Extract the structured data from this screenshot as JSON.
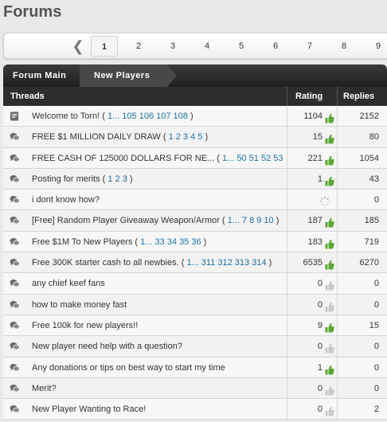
{
  "page_title": "Forums",
  "pagination": {
    "prev_icon": "chevron-left-icon",
    "pages": [
      "1",
      "2",
      "3",
      "4",
      "5",
      "6",
      "7",
      "8",
      "9"
    ],
    "current": "1"
  },
  "breadcrumb": {
    "items": [
      "Forum Main",
      "New Players"
    ]
  },
  "table": {
    "headers": {
      "threads": "Threads",
      "rating": "Rating",
      "replies": "Replies"
    },
    "rows": [
      {
        "icon": "sticky-note-icon",
        "title": "Welcome to Torn!",
        "pages": "1... 105 106 107 108",
        "rating": "1104",
        "thumb": "green",
        "replies": "2152"
      },
      {
        "icon": "chat-bubbles-icon",
        "title": "FREE $1 MILLION DAILY DRAW",
        "pages": "1 2 3 4 5",
        "rating": "15",
        "thumb": "green",
        "replies": "80"
      },
      {
        "icon": "chat-bubbles-icon",
        "title": "FREE CASH OF 125000 DOLLARS FOR NE...",
        "pages": "1... 50 51 52 53",
        "rating": "221",
        "thumb": "green",
        "replies": "1054"
      },
      {
        "icon": "chat-bubbles-icon",
        "title": "Posting for merits",
        "pages": "1 2 3",
        "rating": "1",
        "thumb": "green",
        "replies": "43"
      },
      {
        "icon": "chat-bubbles-icon",
        "title": "i dont know how?",
        "pages": "",
        "rating": "",
        "thumb": "loading",
        "replies": "0"
      },
      {
        "icon": "chat-bubbles-icon",
        "title": "[Free] Random Player Giveaway Weapon/Armor",
        "pages": "1... 7 8 9 10",
        "rating": "187",
        "thumb": "green",
        "replies": "185"
      },
      {
        "icon": "chat-bubbles-icon",
        "title": "Free $1M To New Players",
        "pages": "1... 33 34 35 36",
        "rating": "183",
        "thumb": "green",
        "replies": "719"
      },
      {
        "icon": "chat-bubbles-icon",
        "title": "Free 300K starter cash to all newbies.",
        "pages": "1... 311 312 313 314",
        "rating": "6535",
        "thumb": "green",
        "replies": "6270"
      },
      {
        "icon": "chat-bubbles-icon",
        "title": "any chief keef fans",
        "pages": "",
        "rating": "0",
        "thumb": "grey",
        "replies": "0"
      },
      {
        "icon": "chat-bubbles-icon",
        "title": "how to make money fast",
        "pages": "",
        "rating": "0",
        "thumb": "grey",
        "replies": "0"
      },
      {
        "icon": "chat-bubbles-icon",
        "title": "Free 100k for new players!!",
        "pages": "",
        "rating": "9",
        "thumb": "green",
        "replies": "15"
      },
      {
        "icon": "chat-bubbles-icon",
        "title": "New player need help with a question?",
        "pages": "",
        "rating": "0",
        "thumb": "grey",
        "replies": "0"
      },
      {
        "icon": "chat-bubbles-icon",
        "title": "Any donations or tips on best way to start my time",
        "pages": "",
        "rating": "1",
        "thumb": "green",
        "replies": "0"
      },
      {
        "icon": "chat-bubbles-icon",
        "title": "Merit?",
        "pages": "",
        "rating": "0",
        "thumb": "grey",
        "replies": "0"
      },
      {
        "icon": "chat-bubbles-icon",
        "title": "New Player Wanting to Race!",
        "pages": "",
        "rating": "0",
        "thumb": "grey",
        "replies": "2"
      }
    ]
  },
  "colors": {
    "thumb_green": "#5aa832",
    "thumb_grey": "#c8c8c8",
    "link_blue": "#1a6fa8",
    "header_dark": "#2d2d2d"
  }
}
